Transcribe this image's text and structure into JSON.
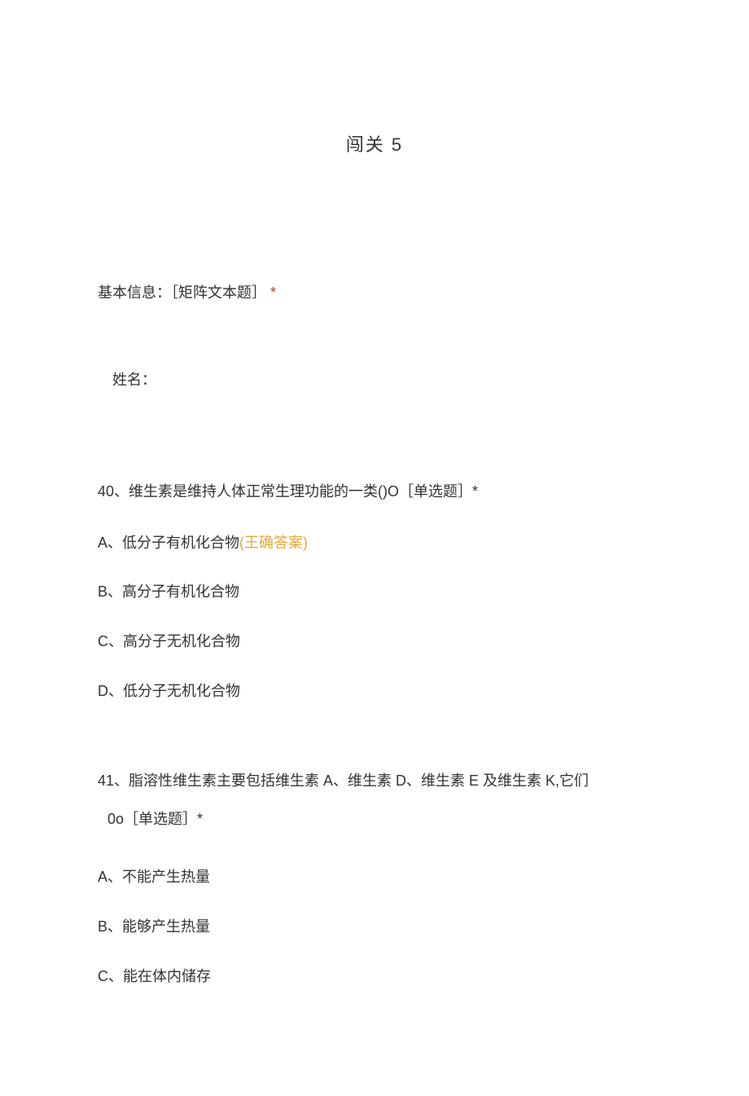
{
  "title": "闯关 5",
  "basic_info": {
    "label": "基本信息：［矩阵文本题］",
    "asterisk": "*"
  },
  "name_label": "姓名：",
  "q40": {
    "stem": "40、维生素是维持人体正常生理功能的一类()O［单选题］*",
    "options": [
      {
        "text": "A、低分子有机化合物",
        "answer": "(王确答案)"
      },
      {
        "text": "B、高分子有机化合物"
      },
      {
        "text": "C、高分子无机化合物"
      },
      {
        "text": "D、低分子无机化合物"
      }
    ]
  },
  "q41": {
    "stem_line1": "41、脂溶性维生素主要包括维生素 A、维生素 D、维生素 E 及维生素 K,它们",
    "stem_line2": "0o［单选题］*",
    "options": [
      {
        "text": "A、不能产生热量"
      },
      {
        "text": "B、能够产生热量"
      },
      {
        "text": "C、能在体内储存"
      }
    ]
  }
}
